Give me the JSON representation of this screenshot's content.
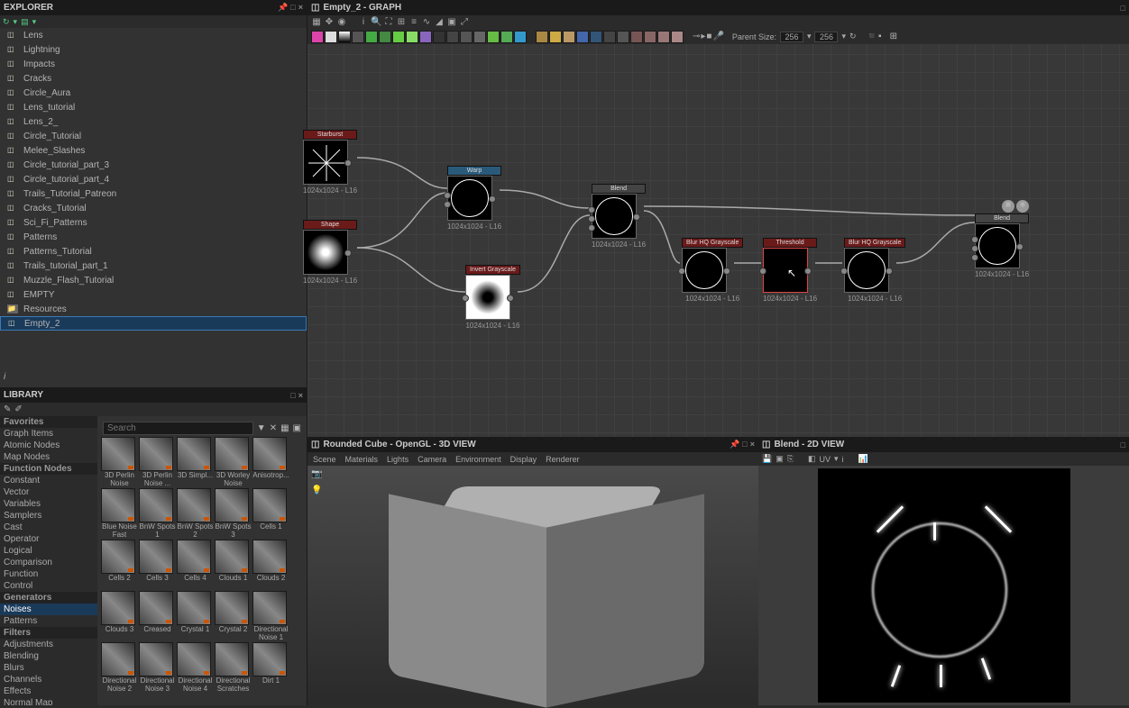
{
  "explorer": {
    "title": "EXPLORER",
    "items": [
      {
        "label": "Lens"
      },
      {
        "label": "Lightning"
      },
      {
        "label": "Impacts"
      },
      {
        "label": "Cracks"
      },
      {
        "label": "Circle_Aura"
      },
      {
        "label": "Lens_tutorial"
      },
      {
        "label": "Lens_2_"
      },
      {
        "label": "Circle_Tutorial"
      },
      {
        "label": "Melee_Slashes"
      },
      {
        "label": "Circle_tutorial_part_3"
      },
      {
        "label": "Circle_tutorial_part_4"
      },
      {
        "label": "Trails_Tutorial_Patreon"
      },
      {
        "label": "Cracks_Tutorial"
      },
      {
        "label": "Sci_Fi_Patterns"
      },
      {
        "label": "Patterns"
      },
      {
        "label": "Patterns_Tutorial"
      },
      {
        "label": "Trails_tutorial_part_1"
      },
      {
        "label": "Muzzle_Flash_Tutorial"
      },
      {
        "label": "EMPTY"
      },
      {
        "label": "Resources",
        "folder": true
      },
      {
        "label": "Empty_2",
        "selected": true
      }
    ]
  },
  "graph": {
    "title": "Empty_2 - GRAPH",
    "parent_size_label": "Parent Size:",
    "parent_w": "256",
    "parent_h": "256",
    "nodes": {
      "n1": {
        "title": "Starburst",
        "footer": "1024x1024 - L16"
      },
      "n2": {
        "title": "Shape",
        "footer": "1024x1024 - L16"
      },
      "n3": {
        "title": "Warp",
        "footer": "1024x1024 - L16"
      },
      "n4": {
        "title": "Invert Grayscale",
        "footer": "1024x1024 - L16"
      },
      "n5": {
        "title": "Blend",
        "footer": "1024x1024 - L16"
      },
      "n6": {
        "title": "Blur HQ Grayscale",
        "footer": "1024x1024 - L16"
      },
      "n7": {
        "title": "Threshold",
        "footer": "1024x1024 - L16"
      },
      "n8": {
        "title": "Blur HQ Grayscale",
        "footer": "1024x1024 - L16"
      },
      "n9": {
        "title": "Blend",
        "footer": "1024x1024 - L16"
      }
    }
  },
  "library": {
    "title": "LIBRARY",
    "search_placeholder": "Search",
    "categories": [
      {
        "label": "Favorites",
        "header": true
      },
      {
        "label": "Graph Items"
      },
      {
        "label": "Atomic Nodes"
      },
      {
        "label": "Map Nodes"
      },
      {
        "label": "Function Nodes",
        "header": true
      },
      {
        "label": "Constant"
      },
      {
        "label": "Vector"
      },
      {
        "label": "Variables"
      },
      {
        "label": "Samplers"
      },
      {
        "label": "Cast"
      },
      {
        "label": "Operator"
      },
      {
        "label": "Logical"
      },
      {
        "label": "Comparison"
      },
      {
        "label": "Function"
      },
      {
        "label": "Control"
      },
      {
        "label": "Generators",
        "header": true
      },
      {
        "label": "Noises",
        "selected": true
      },
      {
        "label": "Patterns"
      },
      {
        "label": "Filters",
        "header": true
      },
      {
        "label": "Adjustments"
      },
      {
        "label": "Blending"
      },
      {
        "label": "Blurs"
      },
      {
        "label": "Channels"
      },
      {
        "label": "Effects"
      },
      {
        "label": "Normal Map"
      }
    ],
    "thumbs": [
      {
        "label": "3D Perlin Noise"
      },
      {
        "label": "3D Perlin Noise ..."
      },
      {
        "label": "3D Simpl..."
      },
      {
        "label": "3D Worley Noise"
      },
      {
        "label": "Anisotrop..."
      },
      {
        "label": "Blue Noise Fast"
      },
      {
        "label": "BnW Spots 1"
      },
      {
        "label": "BnW Spots 2"
      },
      {
        "label": "BnW Spots 3"
      },
      {
        "label": "Cells 1"
      },
      {
        "label": "Cells 2"
      },
      {
        "label": "Cells 3"
      },
      {
        "label": "Cells 4"
      },
      {
        "label": "Clouds 1"
      },
      {
        "label": "Clouds 2"
      },
      {
        "label": "Clouds 3"
      },
      {
        "label": "Creased"
      },
      {
        "label": "Crystal 1"
      },
      {
        "label": "Crystal 2"
      },
      {
        "label": "Directional Noise 1"
      },
      {
        "label": "Directional Noise 2"
      },
      {
        "label": "Directional Noise 3"
      },
      {
        "label": "Directional Noise 4"
      },
      {
        "label": "Directional Scratches"
      },
      {
        "label": "Dirt 1"
      }
    ]
  },
  "view3d": {
    "title": "Rounded Cube - OpenGL - 3D VIEW",
    "tabs": [
      "Scene",
      "Materials",
      "Lights",
      "Camera",
      "Environment",
      "Display",
      "Renderer"
    ]
  },
  "view2d": {
    "title": "Blend - 2D VIEW",
    "uv_label": "UV"
  }
}
